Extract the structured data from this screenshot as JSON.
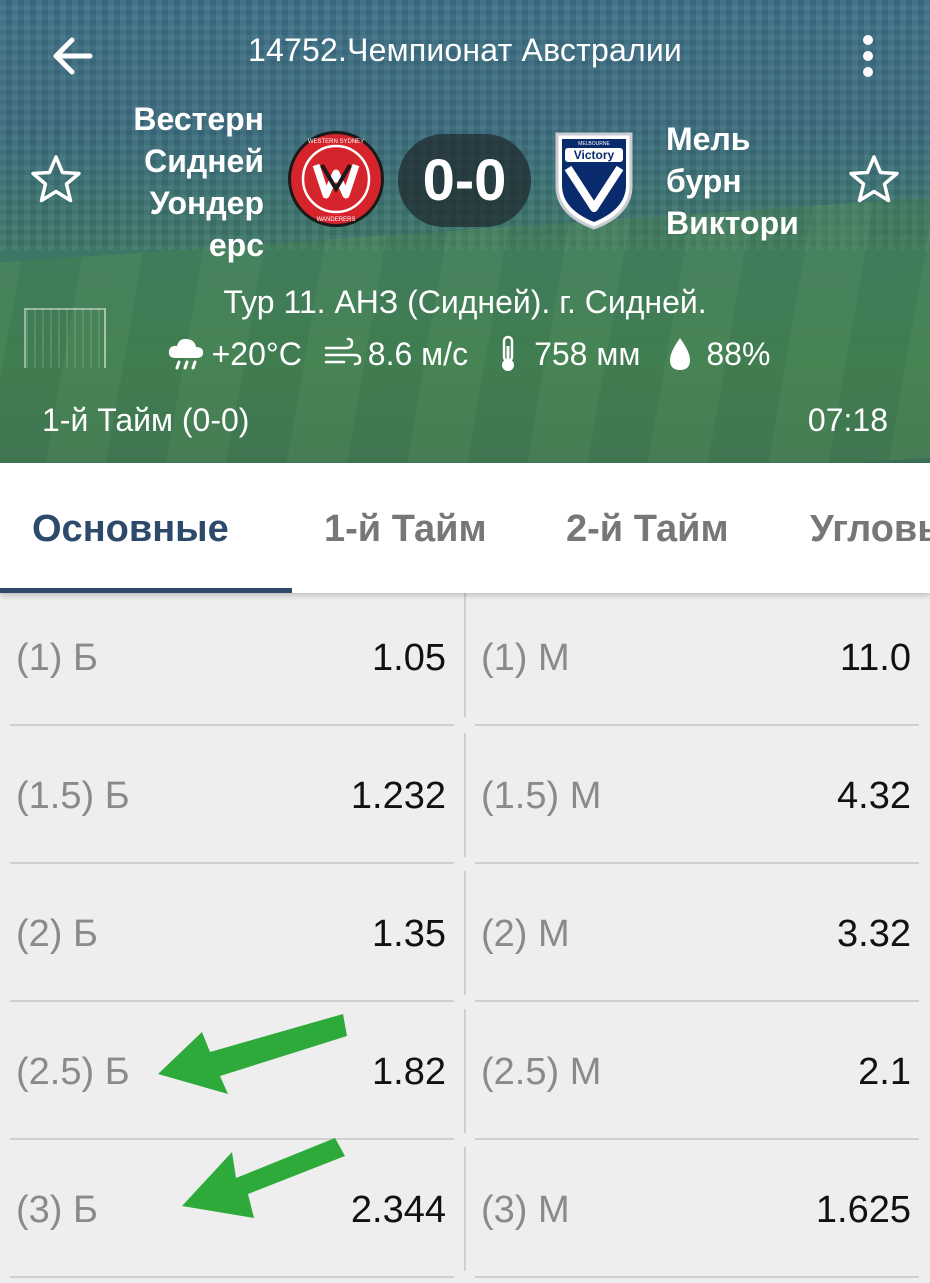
{
  "header": {
    "title": "14752.Чемпионат Австралии",
    "home_team_lines": [
      "Вестерн",
      "Сидней",
      "Уондер",
      "ерс"
    ],
    "away_team_lines": [
      "Мель",
      "бурн",
      "Виктори"
    ],
    "score": "0-0",
    "match_info": "Тур 11. АНЗ (Сидней). г. Сидней.",
    "weather": {
      "temperature": "+20°C",
      "wind": "8.6 м/с",
      "pressure": "758 мм",
      "humidity": "88%"
    },
    "period": "1-й  Тайм (0-0)",
    "clock": "07:18",
    "home_logo_text": "WESTERN SYDNEY WANDERERS FC",
    "away_logo_text": "MELBOURNE Victory FC"
  },
  "tabs": [
    {
      "label": "Основные",
      "active": true
    },
    {
      "label": "1-й  Тайм",
      "active": false
    },
    {
      "label": "2-й  Тайм",
      "active": false
    },
    {
      "label": "Угловые",
      "active": false
    }
  ],
  "odds_rows": [
    {
      "over_label": "(1) Б",
      "over_value": "1.05",
      "under_label": "(1) М",
      "under_value": "11.0"
    },
    {
      "over_label": "(1.5) Б",
      "over_value": "1.232",
      "under_label": "(1.5) М",
      "under_value": "4.32"
    },
    {
      "over_label": "(2) Б",
      "over_value": "1.35",
      "under_label": "(2) М",
      "under_value": "3.32"
    },
    {
      "over_label": "(2.5) Б",
      "over_value": "1.82",
      "under_label": "(2.5) М",
      "under_value": "2.1"
    },
    {
      "over_label": "(3) Б",
      "over_value": "2.344",
      "under_label": "(3) М",
      "under_value": "1.625"
    }
  ],
  "colors": {
    "accent": "#2e4a6b",
    "annotation_arrow": "#2eaa3a",
    "home_logo": "#d5242b",
    "away_logo": "#0a2a6e"
  }
}
